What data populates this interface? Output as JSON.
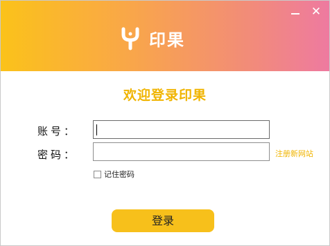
{
  "window": {
    "minimize_label": "—",
    "close_label": "✕"
  },
  "logo": {
    "icon": "y-logo-icon",
    "text": "印果"
  },
  "welcome": "欢迎登录印果",
  "form": {
    "account_label": "账号：",
    "account_value": "",
    "password_label": "密码：",
    "password_value": "",
    "register_link": "注册新网站",
    "remember_label": "记住密码",
    "remember_checked": false,
    "login_button": "登录"
  },
  "colors": {
    "header_gradient": [
      "#fbc21a",
      "#f9a64a",
      "#f28c78",
      "#ee7aa0"
    ],
    "accent": "#f0b400",
    "button": "#f7c01b"
  }
}
